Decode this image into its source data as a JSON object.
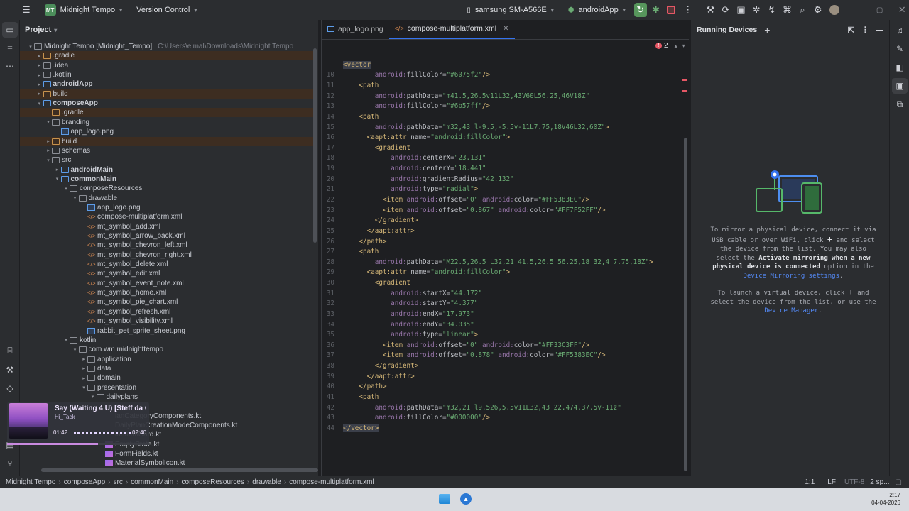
{
  "titlebar": {
    "project_badge": "MT",
    "project_name": "Midnight Tempo",
    "vcs": "Version Control",
    "device": "samsung SM-A566E",
    "run_config": "androidApp"
  },
  "project_panel": {
    "title": "Project",
    "tree": [
      {
        "label": "Midnight Tempo [Midnight_Tempo]",
        "hint": "C:\\Users\\elmal\\Downloads\\Midnight Tempo",
        "depth": 0,
        "arrow": "▾",
        "icon": "fold",
        "excluded": false,
        "bold": false
      },
      {
        "label": ".gradle",
        "depth": 1,
        "arrow": "▸",
        "icon": "fold orange",
        "excluded": true
      },
      {
        "label": ".idea",
        "depth": 1,
        "arrow": "▸",
        "icon": "fold",
        "excluded": false
      },
      {
        "label": ".kotlin",
        "depth": 1,
        "arrow": "▸",
        "icon": "fold",
        "excluded": false
      },
      {
        "label": "androidApp",
        "depth": 1,
        "arrow": "▸",
        "icon": "fold blue",
        "excluded": false,
        "bold": true
      },
      {
        "label": "build",
        "depth": 1,
        "arrow": "▸",
        "icon": "fold orange",
        "excluded": true
      },
      {
        "label": "composeApp",
        "depth": 1,
        "arrow": "▾",
        "icon": "fold blue",
        "excluded": false,
        "bold": true
      },
      {
        "label": ".gradle",
        "depth": 2,
        "arrow": "",
        "icon": "fold orange",
        "excluded": true
      },
      {
        "label": "branding",
        "depth": 2,
        "arrow": "▾",
        "icon": "fold",
        "excluded": false
      },
      {
        "label": "app_logo.png",
        "depth": 3,
        "arrow": "",
        "icon": "png-ic",
        "excluded": false
      },
      {
        "label": "build",
        "depth": 2,
        "arrow": "▸",
        "icon": "fold orange",
        "excluded": true
      },
      {
        "label": "schemas",
        "depth": 2,
        "arrow": "▸",
        "icon": "fold",
        "excluded": false
      },
      {
        "label": "src",
        "depth": 2,
        "arrow": "▾",
        "icon": "fold",
        "excluded": false
      },
      {
        "label": "androidMain",
        "depth": 3,
        "arrow": "▸",
        "icon": "fold blue",
        "excluded": false,
        "bold": true
      },
      {
        "label": "commonMain",
        "depth": 3,
        "arrow": "▾",
        "icon": "fold blue",
        "excluded": false,
        "bold": true
      },
      {
        "label": "composeResources",
        "depth": 4,
        "arrow": "▾",
        "icon": "fold",
        "excluded": false
      },
      {
        "label": "drawable",
        "depth": 5,
        "arrow": "▾",
        "icon": "fold",
        "excluded": false
      },
      {
        "label": "app_logo.png",
        "depth": 6,
        "arrow": "",
        "icon": "png-ic",
        "excluded": false
      },
      {
        "label": "compose-multiplatform.xml",
        "depth": 6,
        "arrow": "",
        "icon": "xml-ic",
        "excluded": false
      },
      {
        "label": "mt_symbol_add.xml",
        "depth": 6,
        "arrow": "",
        "icon": "xml-ic",
        "excluded": false
      },
      {
        "label": "mt_symbol_arrow_back.xml",
        "depth": 6,
        "arrow": "",
        "icon": "xml-ic",
        "excluded": false
      },
      {
        "label": "mt_symbol_chevron_left.xml",
        "depth": 6,
        "arrow": "",
        "icon": "xml-ic",
        "excluded": false
      },
      {
        "label": "mt_symbol_chevron_right.xml",
        "depth": 6,
        "arrow": "",
        "icon": "xml-ic",
        "excluded": false
      },
      {
        "label": "mt_symbol_delete.xml",
        "depth": 6,
        "arrow": "",
        "icon": "xml-ic",
        "excluded": false
      },
      {
        "label": "mt_symbol_edit.xml",
        "depth": 6,
        "arrow": "",
        "icon": "xml-ic",
        "excluded": false
      },
      {
        "label": "mt_symbol_event_note.xml",
        "depth": 6,
        "arrow": "",
        "icon": "xml-ic",
        "excluded": false
      },
      {
        "label": "mt_symbol_home.xml",
        "depth": 6,
        "arrow": "",
        "icon": "xml-ic",
        "excluded": false
      },
      {
        "label": "mt_symbol_pie_chart.xml",
        "depth": 6,
        "arrow": "",
        "icon": "xml-ic",
        "excluded": false
      },
      {
        "label": "mt_symbol_refresh.xml",
        "depth": 6,
        "arrow": "",
        "icon": "xml-ic",
        "excluded": false
      },
      {
        "label": "mt_symbol_visibility.xml",
        "depth": 6,
        "arrow": "",
        "icon": "xml-ic",
        "excluded": false
      },
      {
        "label": "rabbit_pet_sprite_sheet.png",
        "depth": 6,
        "arrow": "",
        "icon": "png-ic",
        "excluded": false
      },
      {
        "label": "kotlin",
        "depth": 4,
        "arrow": "▾",
        "icon": "fold",
        "excluded": false
      },
      {
        "label": "com.wm.midnighttempo",
        "depth": 5,
        "arrow": "▾",
        "icon": "fold",
        "excluded": false
      },
      {
        "label": "application",
        "depth": 6,
        "arrow": "▸",
        "icon": "fold",
        "excluded": false
      },
      {
        "label": "data",
        "depth": 6,
        "arrow": "▸",
        "icon": "fold",
        "excluded": false
      },
      {
        "label": "domain",
        "depth": 6,
        "arrow": "▸",
        "icon": "fold",
        "excluded": false
      },
      {
        "label": "presentation",
        "depth": 6,
        "arrow": "▾",
        "icon": "fold",
        "excluded": false
      },
      {
        "label": "dailyplans",
        "depth": 7,
        "arrow": "▾",
        "icon": "fold",
        "excluded": false
      },
      {
        "label": "s",
        "depth": 8,
        "arrow": "",
        "icon": "",
        "excluded": false
      },
      {
        "label": "lanCategoryComponents.kt",
        "depth": 8,
        "arrow": "",
        "icon": "",
        "excluded": false
      },
      {
        "label": "DailyPlanCreationModeComponents.kt",
        "depth": 8,
        "arrow": "",
        "icon": "",
        "excluded": false
      },
      {
        "label": "lanItemCard.kt",
        "depth": 8,
        "arrow": "",
        "icon": "",
        "excluded": false
      },
      {
        "label": "EmptyState.kt",
        "depth": 8,
        "arrow": "",
        "icon": "kt-ic",
        "excluded": false
      },
      {
        "label": "FormFields.kt",
        "depth": 8,
        "arrow": "",
        "icon": "kt-ic",
        "excluded": false
      },
      {
        "label": "MaterialSymbolIcon.kt",
        "depth": 8,
        "arrow": "",
        "icon": "kt-ic",
        "excluded": false
      }
    ]
  },
  "editor": {
    "tabs": [
      {
        "label": "app_logo.png",
        "active": false
      },
      {
        "label": "compose-multiplatform.xml",
        "active": true
      }
    ],
    "error_count": "2",
    "lines": [
      {
        "n": "",
        "html": "<span class='tag hl'>&lt;vector</span>"
      },
      {
        "n": "10",
        "html": "        <span class='ns'>android:</span><span class='aname'>fillColor</span>=<span class='aval'>\"#6075f2\"</span><span class='tag'>/&gt;</span>"
      },
      {
        "n": "11",
        "html": "    <span class='tag'>&lt;path</span>"
      },
      {
        "n": "12",
        "html": "        <span class='ns'>android:</span><span class='aname'>pathData</span>=<span class='aval'>\"m41.5,26.5v11L32,43V60L56.25,46V18Z\"</span>"
      },
      {
        "n": "13",
        "html": "        <span class='ns'>android:</span><span class='aname'>fillColor</span>=<span class='aval'>\"#6b57ff\"</span><span class='tag'>/&gt;</span>"
      },
      {
        "n": "14",
        "html": "    <span class='tag'>&lt;path</span>"
      },
      {
        "n": "15",
        "html": "        <span class='ns'>android:</span><span class='aname'>pathData</span>=<span class='aval'>\"m32,43 l-9.5,-5.5v-11L7.75,18V46L32,60Z\"</span><span class='tag'>&gt;</span>"
      },
      {
        "n": "16",
        "html": "      <span class='tag'>&lt;aapt:attr</span> <span class='aname'>name</span>=<span class='aval'>\"android:fillColor\"</span><span class='tag'>&gt;</span>"
      },
      {
        "n": "17",
        "html": "        <span class='tag'>&lt;gradient</span>"
      },
      {
        "n": "18",
        "html": "            <span class='ns'>android:</span><span class='aname'>centerX</span>=<span class='aval'>\"23.131\"</span>"
      },
      {
        "n": "19",
        "html": "            <span class='ns'>android:</span><span class='aname'>centerY</span>=<span class='aval'>\"18.441\"</span>"
      },
      {
        "n": "20",
        "html": "            <span class='ns'>android:</span><span class='aname'>gradientRadius</span>=<span class='aval'>\"42.132\"</span>"
      },
      {
        "n": "21",
        "html": "            <span class='ns'>android:</span><span class='aname'>type</span>=<span class='aval'>\"radial\"</span><span class='tag'>&gt;</span>"
      },
      {
        "n": "22",
        "html": "          <span class='tag'>&lt;item</span> <span class='ns'>android:</span><span class='aname'>offset</span>=<span class='aval'>\"0\"</span> <span class='ns'>android:</span><span class='aname'>color</span>=<span class='aval'>\"#FF5383EC\"</span><span class='tag'>/&gt;</span>"
      },
      {
        "n": "23",
        "html": "          <span class='tag'>&lt;item</span> <span class='ns'>android:</span><span class='aname'>offset</span>=<span class='aval'>\"0.867\"</span> <span class='ns'>android:</span><span class='aname'>color</span>=<span class='aval'>\"#FF7F52FF\"</span><span class='tag'>/&gt;</span>"
      },
      {
        "n": "24",
        "html": "        <span class='tag'>&lt;/gradient&gt;</span>"
      },
      {
        "n": "25",
        "html": "      <span class='tag'>&lt;/aapt:attr&gt;</span>"
      },
      {
        "n": "26",
        "html": "    <span class='tag'>&lt;/path&gt;</span>"
      },
      {
        "n": "27",
        "html": "    <span class='tag'>&lt;path</span>"
      },
      {
        "n": "28",
        "html": "        <span class='ns'>android:</span><span class='aname'>pathData</span>=<span class='aval'>\"M22.5,26.5 L32,21 41.5,26.5 56.25,18 32,4 7.75,18Z\"</span><span class='tag'>&gt;</span>"
      },
      {
        "n": "29",
        "html": "      <span class='tag'>&lt;aapt:attr</span> <span class='aname'>name</span>=<span class='aval'>\"android:fillColor\"</span><span class='tag'>&gt;</span>"
      },
      {
        "n": "30",
        "html": "        <span class='tag'>&lt;gradient</span>"
      },
      {
        "n": "31",
        "html": "            <span class='ns'>android:</span><span class='aname'>startX</span>=<span class='aval'>\"44.172\"</span>"
      },
      {
        "n": "32",
        "html": "            <span class='ns'>android:</span><span class='aname'>startY</span>=<span class='aval'>\"4.377\"</span>"
      },
      {
        "n": "33",
        "html": "            <span class='ns'>android:</span><span class='aname'>endX</span>=<span class='aval'>\"17.973\"</span>"
      },
      {
        "n": "34",
        "html": "            <span class='ns'>android:</span><span class='aname'>endY</span>=<span class='aval'>\"34.035\"</span>"
      },
      {
        "n": "35",
        "html": "            <span class='ns'>android:</span><span class='aname'>type</span>=<span class='aval'>\"linear\"</span><span class='tag'>&gt;</span>"
      },
      {
        "n": "36",
        "html": "          <span class='tag'>&lt;item</span> <span class='ns'>android:</span><span class='aname'>offset</span>=<span class='aval'>\"0\"</span> <span class='ns'>android:</span><span class='aname'>color</span>=<span class='aval'>\"#FF33C3FF\"</span><span class='tag'>/&gt;</span>"
      },
      {
        "n": "37",
        "html": "          <span class='tag'>&lt;item</span> <span class='ns'>android:</span><span class='aname'>offset</span>=<span class='aval'>\"0.878\"</span> <span class='ns'>android:</span><span class='aname'>color</span>=<span class='aval'>\"#FF5383EC\"</span><span class='tag'>/&gt;</span>"
      },
      {
        "n": "38",
        "html": "        <span class='tag'>&lt;/gradient&gt;</span>"
      },
      {
        "n": "39",
        "html": "      <span class='tag'>&lt;/aapt:attr&gt;</span>"
      },
      {
        "n": "40",
        "html": "    <span class='tag'>&lt;/path&gt;</span>"
      },
      {
        "n": "41",
        "html": "    <span class='tag'>&lt;path</span>"
      },
      {
        "n": "42",
        "html": "        <span class='ns'>android:</span><span class='aname'>pathData</span>=<span class='aval'>\"m32,21 l9.526,5.5v11L32,43 22.474,37.5v-11z\"</span>"
      },
      {
        "n": "43",
        "html": "        <span class='ns'>android:</span><span class='aname'>fillColor</span>=<span class='aval'>\"#000000\"</span><span class='tag'>/&gt;</span>"
      },
      {
        "n": "44",
        "html": "<span class='tag hl'>&lt;/vector&gt;</span>"
      }
    ]
  },
  "devices": {
    "title": "Running Devices",
    "para1_a": "To mirror a physical device, connect it via USB cable or over WiFi, click ",
    "para1_b": " and select the device from the list. You may also select the ",
    "para1_bold1": "Activate mirroring when a new physical device is connected",
    "para1_c": " option in the ",
    "para1_link": "Device Mirroring settings",
    "para1_end": ".",
    "para2_a": "To launch a virtual device, click ",
    "para2_b": " and select the device from the list, or use the ",
    "para2_link": "Device Manager",
    "para2_end": "."
  },
  "statusbar": {
    "crumbs": [
      "Midnight Tempo",
      "composeApp",
      "src",
      "commonMain",
      "composeResources",
      "drawable",
      "compose-multiplatform.xml"
    ],
    "position": "1:1",
    "line_sep": "LF",
    "encoding": "UTF-8",
    "indent": "2 sp..."
  },
  "media": {
    "title": "Say (Waiting 4 U) [Steff da C",
    "artist": "Hi_Tack",
    "current": "01:42",
    "duration": "02:40",
    "progress": 0.64
  },
  "taskbar": {
    "time": "2:17",
    "date": "04-04-2026"
  }
}
